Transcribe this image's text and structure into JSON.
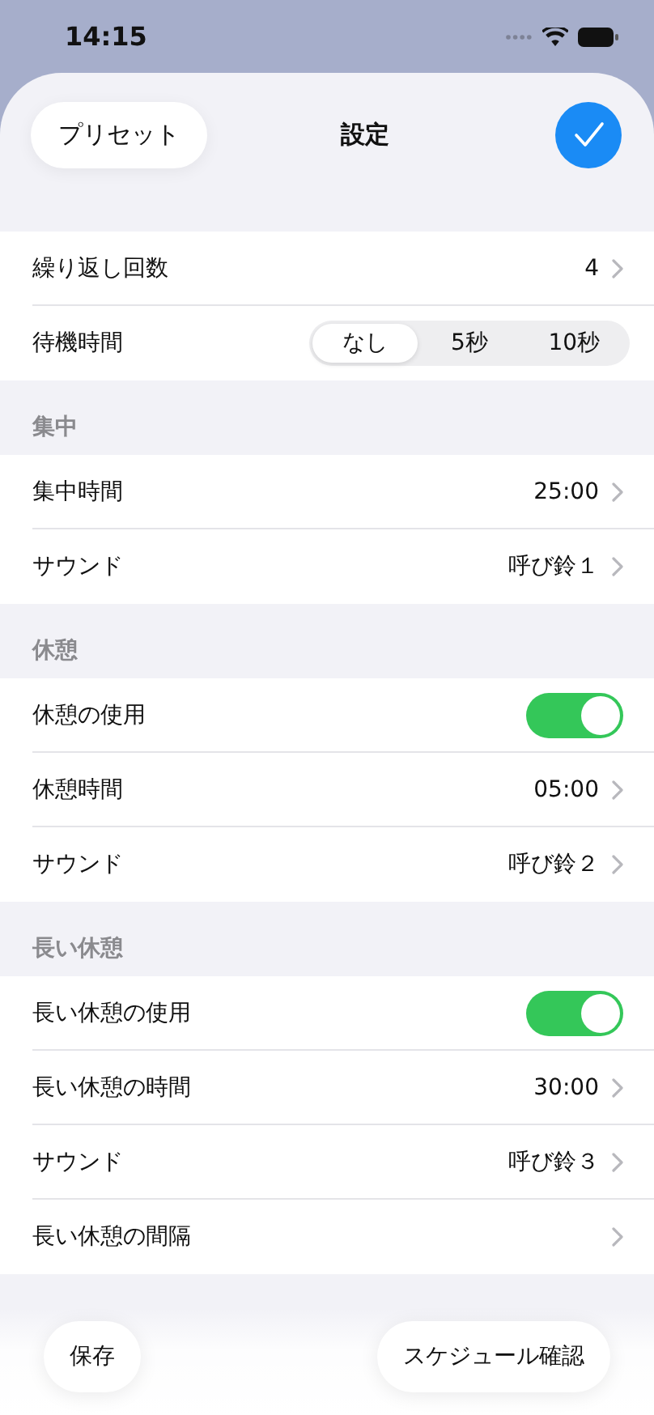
{
  "status_bar": {
    "time": "14:15"
  },
  "header": {
    "left_button": "プリセット",
    "title": "設定"
  },
  "sections": [
    {
      "rows": [
        {
          "kind": "value",
          "label": "繰り返し回数",
          "value": "4"
        },
        {
          "kind": "segmented",
          "label": "待機時間",
          "options": [
            {
              "label": "なし",
              "selected": true
            },
            {
              "label": "5秒",
              "selected": false
            },
            {
              "label": "10秒",
              "selected": false
            }
          ]
        }
      ]
    },
    {
      "header": "集中",
      "rows": [
        {
          "kind": "value",
          "label": "集中時間",
          "value": "25:00"
        },
        {
          "kind": "value",
          "label": "サウンド",
          "value": "呼び鈴１"
        }
      ]
    },
    {
      "header": "休憩",
      "rows": [
        {
          "kind": "toggle",
          "label": "休憩の使用",
          "on": true
        },
        {
          "kind": "value",
          "label": "休憩時間",
          "value": "05:00"
        },
        {
          "kind": "value",
          "label": "サウンド",
          "value": "呼び鈴２"
        }
      ]
    },
    {
      "header": "長い休憩",
      "rows": [
        {
          "kind": "toggle",
          "label": "長い休憩の使用",
          "on": true
        },
        {
          "kind": "value",
          "label": "長い休憩の時間",
          "value": "30:00"
        },
        {
          "kind": "value",
          "label": "サウンド",
          "value": "呼び鈴３"
        },
        {
          "kind": "value",
          "label": "長い休憩の間隔"
        }
      ]
    }
  ],
  "bottom_buttons": [
    {
      "label": "保存"
    },
    {
      "label": "スケジュール確認"
    }
  ]
}
